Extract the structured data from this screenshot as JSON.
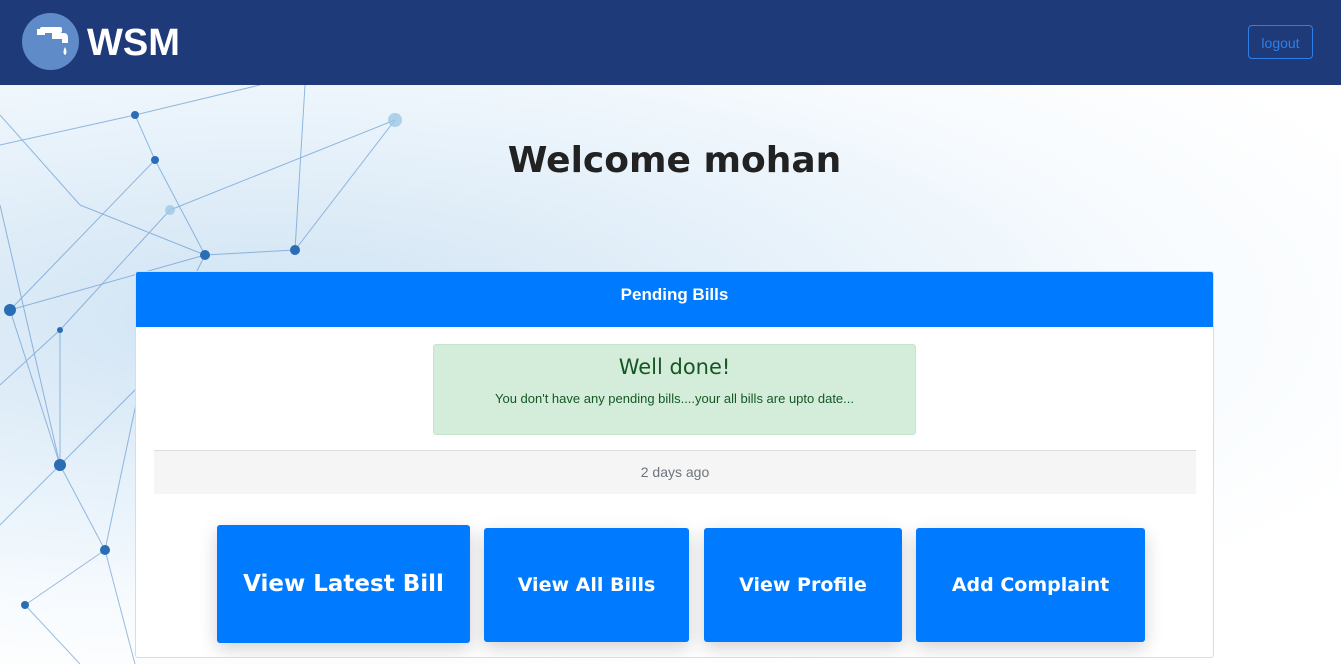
{
  "navbar": {
    "brand": "WSM",
    "logo_icon": "water-tap-icon",
    "logout_label": "logout",
    "background": "#1f3a78"
  },
  "welcome": "Welcome mohan",
  "card": {
    "header": "Pending Bills",
    "alert": {
      "title": "Well done!",
      "text": "You don't have any pending bills....your all bills are upto date..."
    },
    "footer": "2 days ago",
    "actions": {
      "latest": "View Latest Bill",
      "all": "View All Bills",
      "profile": "View Profile",
      "complaint": "Add Complaint"
    }
  },
  "colors": {
    "primary": "#007bff",
    "success_bg": "#d4edda",
    "success_text": "#155724"
  }
}
